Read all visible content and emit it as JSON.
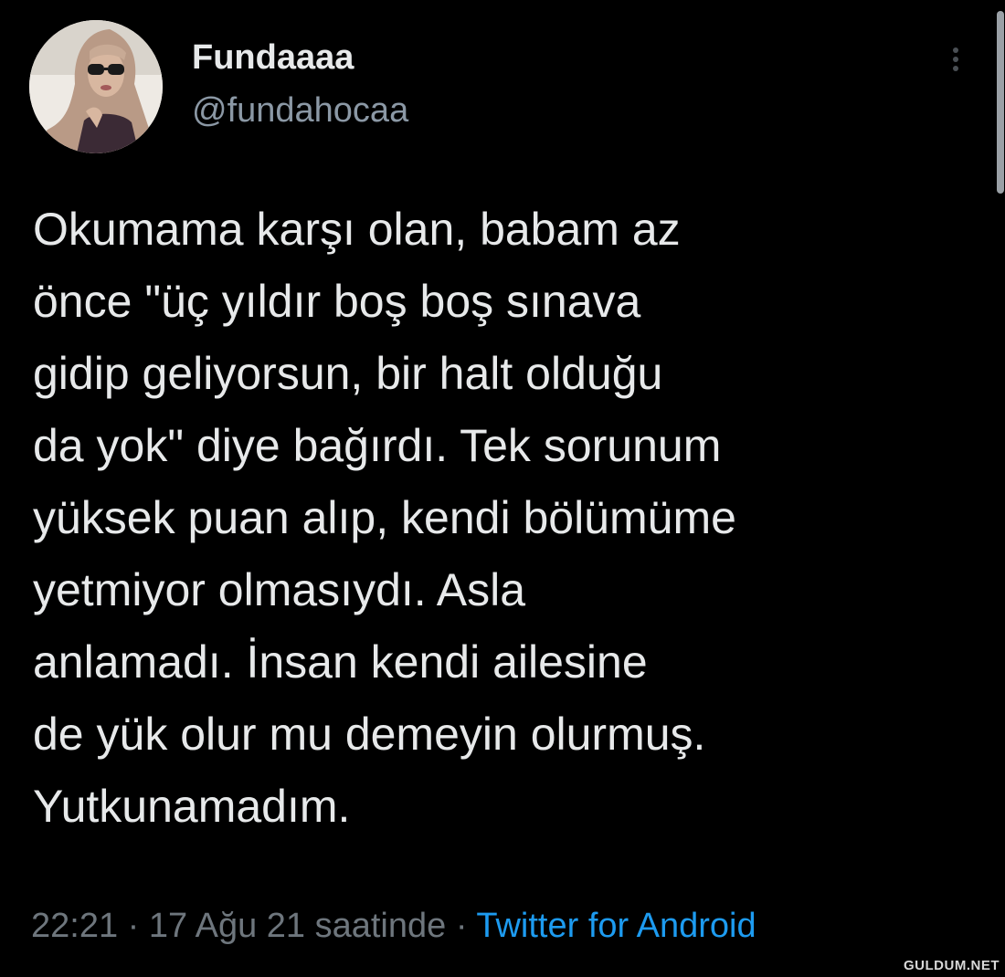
{
  "tweet": {
    "author": {
      "display_name": "Fundaaaa",
      "handle": "@fundahocaa"
    },
    "text_lines": [
      "Okumama karşı olan, babam az",
      "önce \"üç yıldır boş boş sınava",
      "gidip geliyorsun, bir halt olduğu",
      "da yok\" diye bağırdı. Tek sorunum",
      "yüksek puan alıp, kendi bölümüme",
      "yetmiyor olmasıydı. Asla",
      "anlamadı. İnsan kendi ailesine",
      "de yük olur mu demeyin olurmuş.",
      "Yutkunamadım."
    ],
    "meta": {
      "time": "22:21",
      "separator": " · ",
      "date": "17 Ağu 21 saatinde",
      "separator2": " · ",
      "source": "Twitter for Android"
    }
  },
  "watermark": "GULDUM.NET",
  "colors": {
    "background": "#000000",
    "text": "#e7e9ea",
    "secondary": "#8b98a5",
    "link": "#1d9bf0"
  },
  "icons": {
    "more": "more-vertical-icon"
  }
}
